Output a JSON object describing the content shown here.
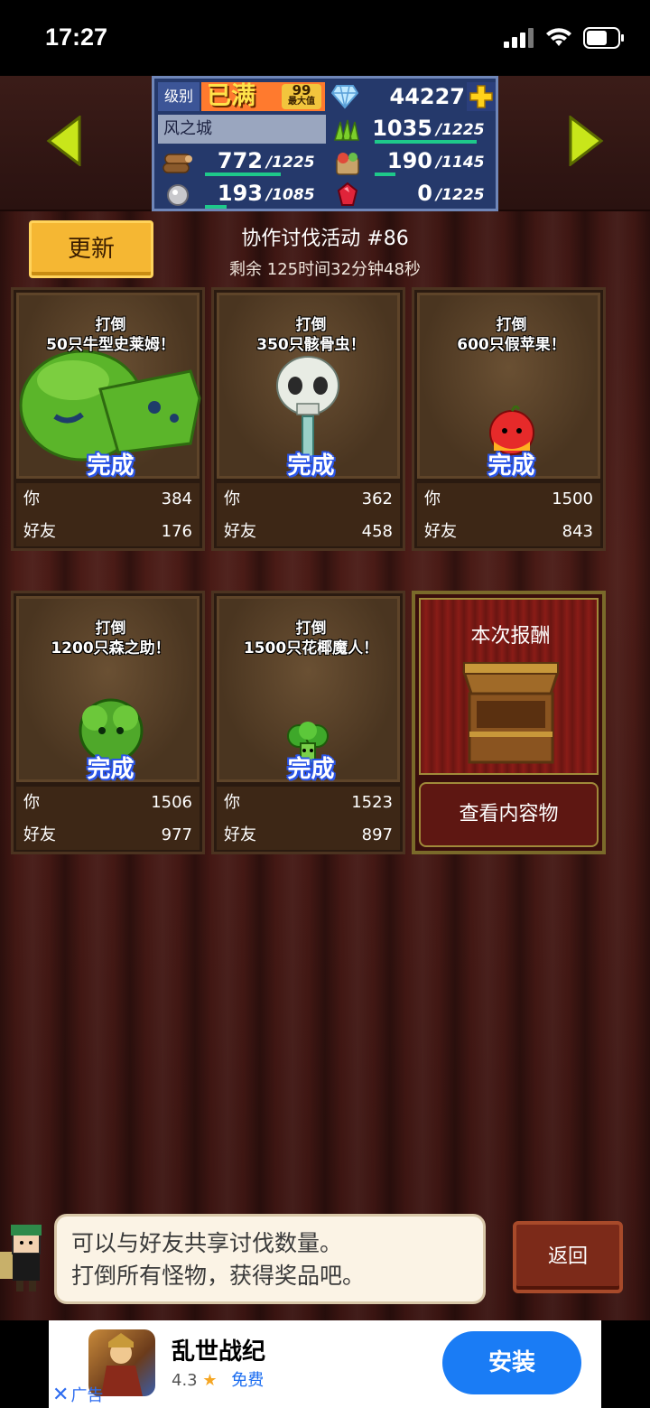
{
  "status_bar": {
    "time": "17:27"
  },
  "header": {
    "level_label": "级别",
    "level_value": "已满",
    "level_max_number": "99",
    "level_max_text": "最大值",
    "gems": "44227",
    "town_name": "风之城",
    "resources": [
      {
        "icon": "wood-icon",
        "current": "772",
        "capacity": "/1225",
        "fill": 0.63
      },
      {
        "icon": "grass-icon",
        "current": "1035",
        "capacity": "/1225",
        "fill": 0.84
      },
      {
        "icon": "food-icon",
        "current": "190",
        "capacity": "/1145",
        "fill": 0.17
      },
      {
        "icon": "ore-icon",
        "current": "193",
        "capacity": "/1085",
        "fill": 0.18
      },
      {
        "icon": "ruby-icon",
        "current": "0",
        "capacity": "/1225",
        "fill": 0.0
      }
    ]
  },
  "event": {
    "refresh_label": "更新",
    "title": "协作讨伐活动 #86",
    "remaining": "剩余 125时间32分钟48秒"
  },
  "missions": [
    {
      "action": "打倒",
      "target": "50只牛型史莱姆！",
      "status": "完成",
      "you_label": "你",
      "you": "384",
      "friend_label": "好友",
      "friend": "176",
      "monster": "slime"
    },
    {
      "action": "打倒",
      "target": "350只骸骨虫！",
      "status": "完成",
      "you_label": "你",
      "you": "362",
      "friend_label": "好友",
      "friend": "458",
      "monster": "skull"
    },
    {
      "action": "打倒",
      "target": "600只假苹果！",
      "status": "完成",
      "you_label": "你",
      "you": "1500",
      "friend_label": "好友",
      "friend": "843",
      "monster": "apple"
    },
    {
      "action": "打倒",
      "target": "1200只森之助！",
      "status": "完成",
      "you_label": "你",
      "you": "1506",
      "friend_label": "好友",
      "friend": "977",
      "monster": "bush"
    },
    {
      "action": "打倒",
      "target": "1500只花椰魔人！",
      "status": "完成",
      "you_label": "你",
      "you": "1523",
      "friend_label": "好友",
      "friend": "897",
      "monster": "broccoli"
    }
  ],
  "reward": {
    "title": "本次报酬",
    "view_button": "查看内容物"
  },
  "tip": {
    "line1": "可以与好友共享讨伐数量。",
    "line2": "打倒所有怪物，获得奖品吧。"
  },
  "back_label": "返回",
  "ad": {
    "name": "乱世战纪",
    "rating": "4.3",
    "price": "免费",
    "install": "安装",
    "label": "广告"
  }
}
